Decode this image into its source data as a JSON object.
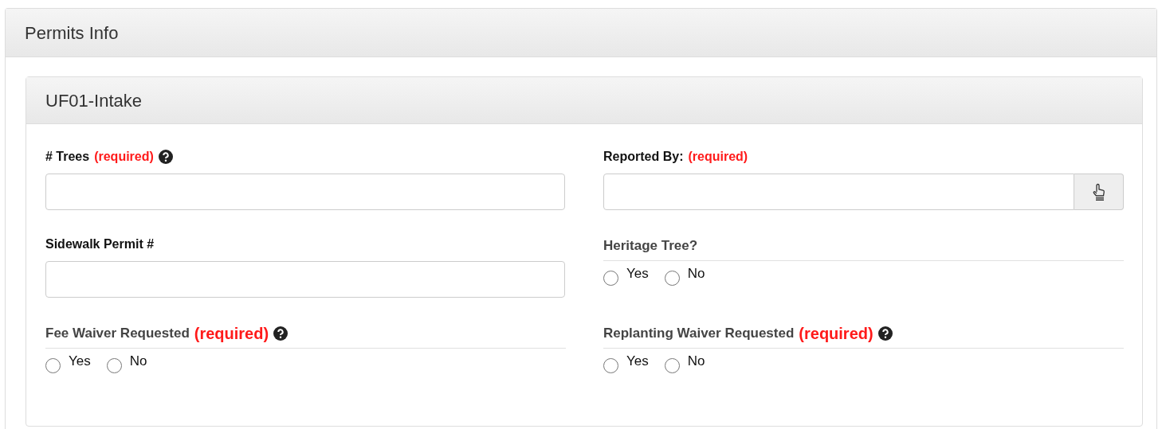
{
  "panel": {
    "title": "Permits Info"
  },
  "section": {
    "title": "UF01-Intake"
  },
  "fields": [
    {
      "kind": "text",
      "label": "# Trees",
      "required": "(required)",
      "help": true
    },
    {
      "kind": "picker",
      "label": "Reported By:",
      "required": "(required)",
      "help": false
    },
    {
      "kind": "text",
      "label": "Sidewalk Permit #",
      "help": false
    },
    {
      "kind": "radio",
      "label": "Heritage Tree?",
      "help": false,
      "options": [
        {
          "label": "Yes",
          "selected": false
        },
        {
          "label": "No",
          "selected": false
        }
      ]
    },
    {
      "kind": "radio",
      "label": "Fee Waiver Requested",
      "required": "(required)",
      "help": true,
      "options": [
        {
          "label": "Yes",
          "selected": false
        },
        {
          "label": "No",
          "selected": false
        }
      ]
    },
    {
      "kind": "radio",
      "label": "Replanting Waiver Requested",
      "required": "(required)",
      "help": true,
      "options": [
        {
          "label": "Yes",
          "selected": false
        },
        {
          "label": "No",
          "selected": false
        }
      ]
    }
  ]
}
